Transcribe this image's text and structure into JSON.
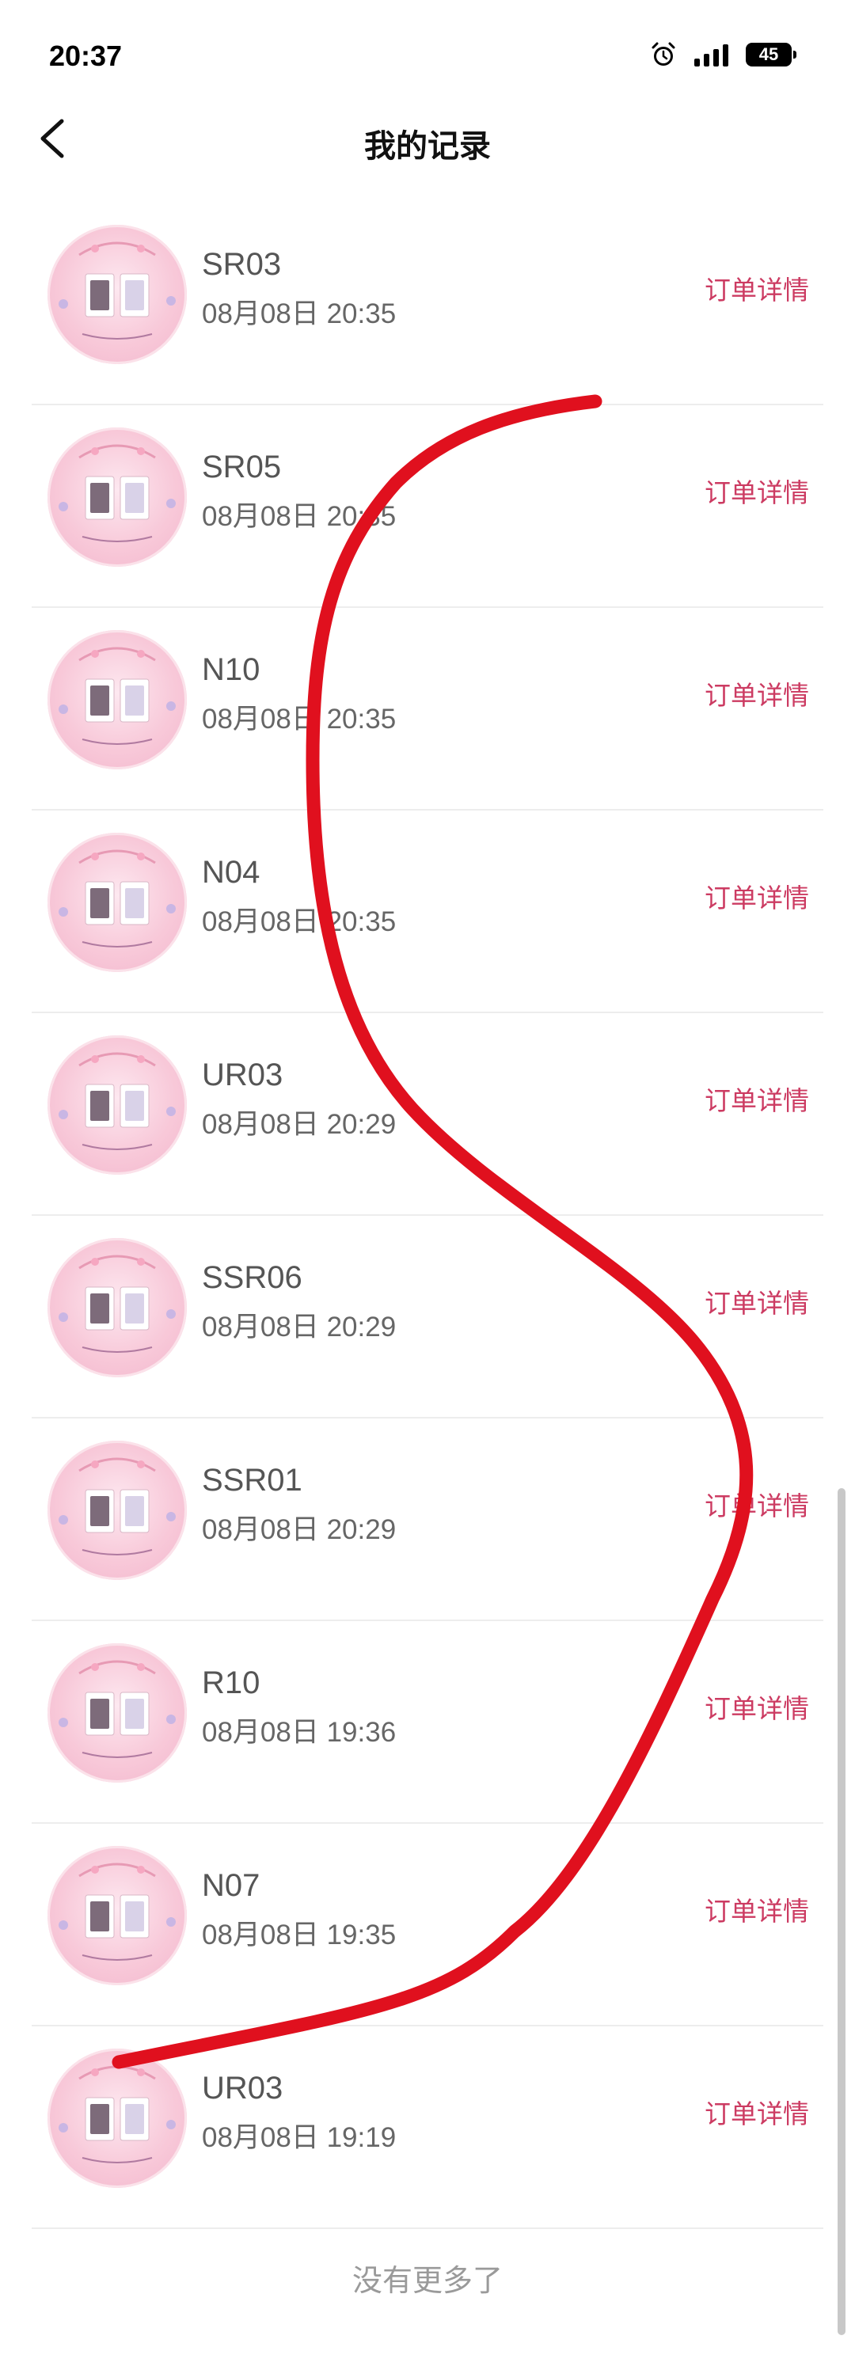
{
  "status_bar": {
    "time": "20:37",
    "battery": "45",
    "icons": [
      "alarm-icon",
      "signal-icon",
      "battery-icon"
    ]
  },
  "nav": {
    "title": "我的记录",
    "back_icon": "chevron-left-icon"
  },
  "records": [
    {
      "code": "SR03",
      "time": "08月08日 20:35",
      "action": "订单详情"
    },
    {
      "code": "SR05",
      "time": "08月08日 20:35",
      "action": "订单详情"
    },
    {
      "code": "N10",
      "time": "08月08日 20:35",
      "action": "订单详情"
    },
    {
      "code": "N04",
      "time": "08月08日 20:35",
      "action": "订单详情"
    },
    {
      "code": "UR03",
      "time": "08月08日 20:29",
      "action": "订单详情"
    },
    {
      "code": "SSR06",
      "time": "08月08日 20:29",
      "action": "订单详情"
    },
    {
      "code": "SSR01",
      "time": "08月08日 20:29",
      "action": "订单详情"
    },
    {
      "code": "R10",
      "time": "08月08日 19:36",
      "action": "订单详情"
    },
    {
      "code": "N07",
      "time": "08月08日 19:35",
      "action": "订单详情"
    },
    {
      "code": "UR03",
      "time": "08月08日 19:19",
      "action": "订单详情"
    }
  ],
  "footer": {
    "no_more": "没有更多了"
  },
  "colors": {
    "accent": "#cc3b62",
    "scribble": "#e0101e",
    "thumb_bg": "#f8c9d9"
  }
}
